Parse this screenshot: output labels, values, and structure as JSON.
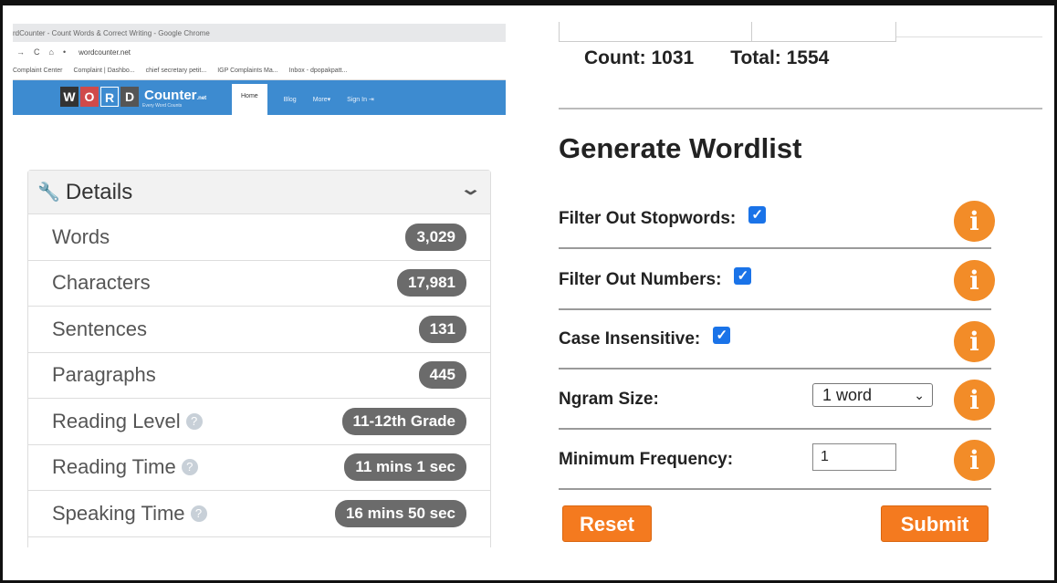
{
  "browser": {
    "title": "rdCounter - Count Words & Correct Writing - Google Chrome",
    "url": "wordcounter.net",
    "bookmarks": [
      "Complaint Center",
      "Complaint | Dashbo...",
      "chief secretary petit...",
      "IGP Complaints Ma...",
      "Inbox - dpopakpatt..."
    ]
  },
  "site": {
    "logo_letters": [
      "W",
      "O",
      "R",
      "D"
    ],
    "logo_colors": [
      "#333333",
      "#d04a4a",
      "#3d8bd0",
      "#555555"
    ],
    "logo_counter": "Counter",
    "logo_suffix": ".net",
    "logo_tagline": "Every Word Counts",
    "nav": [
      "Home",
      "Blog",
      "More▾",
      "Sign In"
    ]
  },
  "details": {
    "title": "Details",
    "rows": [
      {
        "label": "Words",
        "value": "3,029",
        "help": false
      },
      {
        "label": "Characters",
        "value": "17,981",
        "help": false
      },
      {
        "label": "Sentences",
        "value": "131",
        "help": false
      },
      {
        "label": "Paragraphs",
        "value": "445",
        "help": false
      },
      {
        "label": "Reading Level",
        "value": "11-12th Grade",
        "help": true
      },
      {
        "label": "Reading Time",
        "value": "11 mins 1 sec",
        "help": true
      },
      {
        "label": "Speaking Time",
        "value": "16 mins 50 sec",
        "help": true
      }
    ]
  },
  "counts": {
    "count_label": "Count: 1031",
    "total_label": "Total: 1554"
  },
  "wordlist": {
    "title": "Generate Wordlist",
    "options": [
      {
        "label": "Filter Out Stopwords:",
        "checked": true
      },
      {
        "label": "Filter Out Numbers:",
        "checked": true
      },
      {
        "label": "Case Insensitive:",
        "checked": true
      }
    ],
    "ngram_label": "Ngram Size:",
    "ngram_value": "1 word",
    "minfreq_label": "Minimum Frequency:",
    "minfreq_value": "1",
    "reset_label": "Reset",
    "submit_label": "Submit",
    "info_glyph": "i",
    "accent": "#f47a1f"
  }
}
